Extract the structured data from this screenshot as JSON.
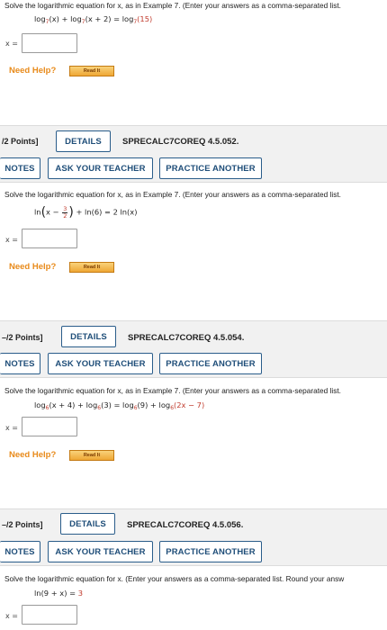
{
  "q1": {
    "instruction": "Solve the logarithmic equation for x, as in Example 7. (Enter your answers as a comma-separated list.",
    "equation": {
      "a": "log",
      "b": "7",
      "c": "(x) + log",
      "d": "7",
      "e": "(x + 2) = log",
      "f": "7",
      "g": "(15)"
    },
    "x_label": "x =",
    "need_help": "Need Help?",
    "read_it": "Read It"
  },
  "q2": {
    "points": "/2 Points]",
    "details": "DETAILS",
    "code": "SPRECALC7COREQ 4.5.052.",
    "notes": "NOTES",
    "ask": "ASK YOUR TEACHER",
    "practice": "PRACTICE ANOTHER",
    "instruction": "Solve the logarithmic equation for x, as in Example 7. (Enter your answers as a comma-separated list.",
    "equation": {
      "a": "ln",
      "b": "x −",
      "num": "3",
      "den": "2",
      "c": "+ ln(6) = 2 ln(x)"
    },
    "x_label": "x =",
    "need_help": "Need Help?",
    "read_it": "Read It"
  },
  "q3": {
    "points": "–/2 Points]",
    "details": "DETAILS",
    "code": "SPRECALC7COREQ 4.5.054.",
    "notes": "NOTES",
    "ask": "ASK YOUR TEACHER",
    "practice": "PRACTICE ANOTHER",
    "instruction": "Solve the logarithmic equation for x, as in Example 7. (Enter your answers as a comma-separated list.",
    "equation": {
      "a": "log",
      "b": "6",
      "c": "(x + 4) + log",
      "d": "6",
      "e": "(3) = log",
      "f": "6",
      "g": "(9) + log",
      "h": "6",
      "i": "(2x − 7)"
    },
    "x_label": "x =",
    "need_help": "Need Help?",
    "read_it": "Read It"
  },
  "q4": {
    "points": "–/2 Points]",
    "details": "DETAILS",
    "code": "SPRECALC7COREQ 4.5.056.",
    "notes": "NOTES",
    "ask": "ASK YOUR TEACHER",
    "practice": "PRACTICE ANOTHER",
    "instruction": "Solve the logarithmic equation for x. (Enter your answers as a comma-separated list. Round your answ",
    "equation": {
      "a": "ln(9 + x) = ",
      "b": "3"
    },
    "x_label": "x ="
  }
}
